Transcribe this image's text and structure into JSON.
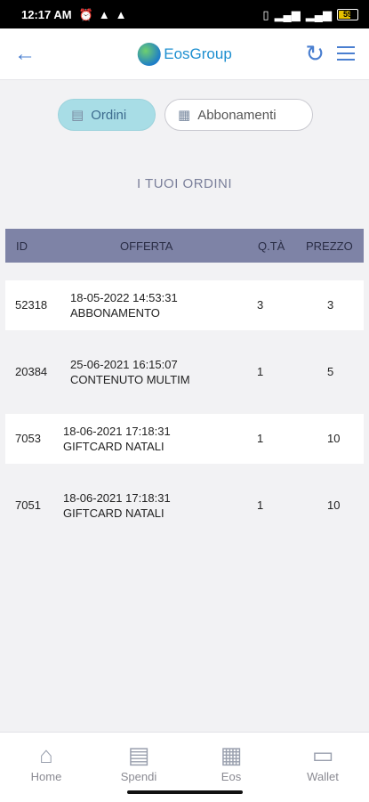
{
  "status_bar": {
    "time": "12:17 AM",
    "left_icons": [
      "alarm-icon",
      "warning-icon",
      "warning-icon"
    ],
    "right_icons": [
      "vibrate-icon",
      "signal-icon",
      "wifi-signal-icon",
      "battery-icon"
    ],
    "battery_level": "59"
  },
  "app_bar": {
    "back_icon": "←",
    "logo_text": "EosGroup",
    "refresh_icon": "↻"
  },
  "tabs": [
    {
      "label": "Ordini",
      "icon": "store-icon",
      "active": true
    },
    {
      "label": "Abbonamenti",
      "icon": "calendar-icon",
      "active": false
    }
  ],
  "section_title": "I TUOI ORDINI",
  "table": {
    "headers": {
      "id": "ID",
      "offerta": "OFFERTA",
      "qta": "Q.TÀ",
      "prezzo": "PREZZO"
    },
    "rows": [
      {
        "id": "52318",
        "date": "18-05-2022 14:53:31",
        "offer": "ABBONAMENTO",
        "qta": "3",
        "prezzo": "3"
      },
      {
        "id": "20384",
        "date": "25-06-2021 16:15:07",
        "offer": "CONTENUTO MULTIM",
        "qta": "1",
        "prezzo": "5"
      },
      {
        "id": "7053",
        "date": "18-06-2021 17:18:31",
        "offer": "GIFTCARD NATALI",
        "qta": "1",
        "prezzo": "10"
      },
      {
        "id": "7051",
        "date": "18-06-2021 17:18:31",
        "offer": "GIFTCARD NATALI",
        "qta": "1",
        "prezzo": "10"
      }
    ]
  },
  "bottom_nav": [
    {
      "label": "Home",
      "icon": "home-icon"
    },
    {
      "label": "Spendi",
      "icon": "shop-icon"
    },
    {
      "label": "Eos",
      "icon": "building-icon"
    },
    {
      "label": "Wallet",
      "icon": "wallet-icon"
    }
  ]
}
